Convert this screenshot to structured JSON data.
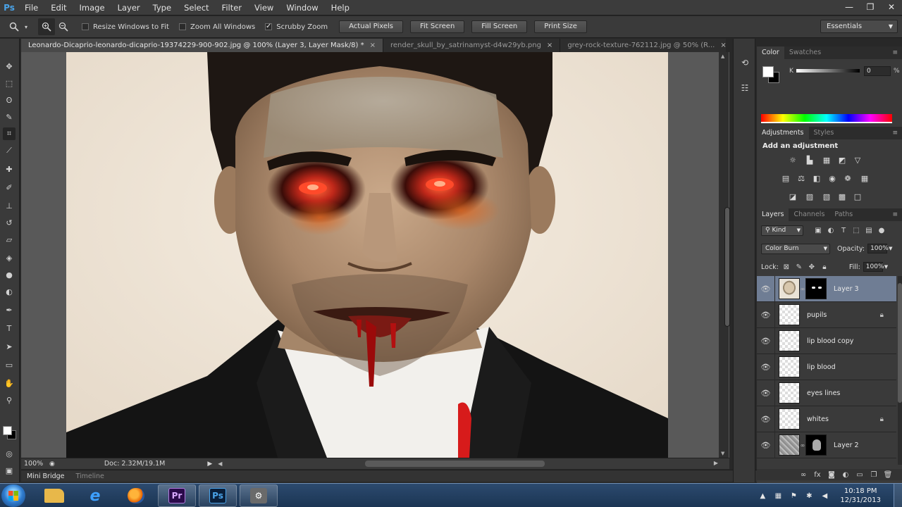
{
  "app": {
    "logo": "Ps"
  },
  "menu": [
    "File",
    "Edit",
    "Image",
    "Layer",
    "Type",
    "Select",
    "Filter",
    "View",
    "Window",
    "Help"
  ],
  "window_controls": {
    "minimize": "—",
    "restore": "❐",
    "close": "✕"
  },
  "options": {
    "checks": [
      {
        "label": "Resize Windows to Fit",
        "checked": false
      },
      {
        "label": "Zoom All Windows",
        "checked": false
      },
      {
        "label": "Scrubby Zoom",
        "checked": true
      }
    ],
    "buttons": [
      "Actual Pixels",
      "Fit Screen",
      "Fill Screen",
      "Print Size"
    ],
    "workspace": "Essentials"
  },
  "tabs": [
    {
      "label": "Leonardo-Dicaprio-leonardo-dicaprio-19374229-900-902.jpg @ 100% (Layer 3, Layer Mask/8) *",
      "active": true
    },
    {
      "label": "render_skull_by_satrinamyst-d4w29yb.png",
      "active": false
    },
    {
      "label": "grey-rock-texture-762112.jpg @ 50% (R...",
      "active": false
    }
  ],
  "status": {
    "zoom": "100%",
    "doc": "Doc: 2.32M/19.1M"
  },
  "minibridge": {
    "tab1": "Mini Bridge",
    "tab2": "Timeline"
  },
  "color_panel": {
    "tabs": [
      "Color",
      "Swatches"
    ],
    "k_label": "K",
    "k_value": "0",
    "k_unit": "%",
    "fg": "#ffffff",
    "bg": "#000000"
  },
  "adjustments": {
    "tabs": [
      "Adjustments",
      "Styles"
    ],
    "title": "Add an adjustment"
  },
  "layers": {
    "tabs": [
      "Layers",
      "Channels",
      "Paths"
    ],
    "kind": "Kind",
    "blend_mode": "Color Burn",
    "opacity_label": "Opacity:",
    "opacity": "100%",
    "lock_label": "Lock:",
    "fill_label": "Fill:",
    "fill": "100%",
    "items": [
      {
        "name": "Layer 3",
        "selected": true,
        "thumb": "face",
        "mask": "eyes",
        "locked": false
      },
      {
        "name": "pupils",
        "selected": false,
        "thumb": "transparent",
        "mask": "",
        "locked": true
      },
      {
        "name": "lip blood copy",
        "selected": false,
        "thumb": "transparent",
        "mask": "",
        "locked": false
      },
      {
        "name": "lip blood",
        "selected": false,
        "thumb": "transparent",
        "mask": "",
        "locked": false
      },
      {
        "name": "eyes lines",
        "selected": false,
        "thumb": "transparent",
        "mask": "",
        "locked": false
      },
      {
        "name": "whites",
        "selected": false,
        "thumb": "transparent",
        "mask": "",
        "locked": true
      },
      {
        "name": "Layer 2",
        "selected": false,
        "thumb": "texture",
        "mask": "skull",
        "locked": false
      }
    ]
  },
  "taskbar": {
    "apps": [
      {
        "name": "explorer",
        "glyph": "",
        "bg": "#e8b84a"
      },
      {
        "name": "internet-explorer",
        "glyph": "e",
        "bg": "#2a7de1"
      },
      {
        "name": "firefox",
        "glyph": "",
        "bg": "#e66000"
      },
      {
        "name": "premiere",
        "glyph": "Pr",
        "bg": "#2a0a4a"
      },
      {
        "name": "photoshop",
        "glyph": "Ps",
        "bg": "#0a1f3a"
      },
      {
        "name": "tool",
        "glyph": "⚙",
        "bg": "#6a6a6a"
      }
    ],
    "time": "10:18 PM",
    "date": "12/31/2013"
  },
  "colors": {
    "accent_selected": "#6f7d94",
    "ps_blue": "#4aa3e8"
  }
}
